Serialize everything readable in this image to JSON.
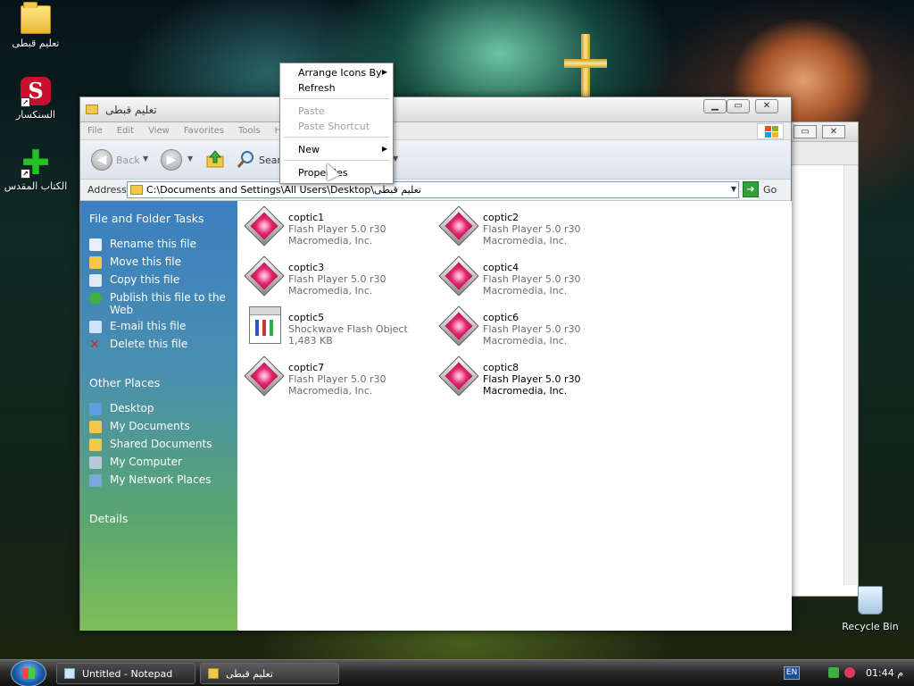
{
  "desktop": {
    "icons": [
      {
        "label": "تعليم قبطى"
      },
      {
        "label": "السنكسار"
      },
      {
        "label": "الكتاب المقدس"
      }
    ],
    "recycle_bin_label": "Recycle Bin"
  },
  "window": {
    "title": "تعليم قبطى",
    "menu": [
      "File",
      "Edit",
      "View",
      "Favorites",
      "Tools",
      "Help"
    ],
    "toolbar": {
      "back_label": "Back",
      "search_label": "Search"
    },
    "address": {
      "label": "Address",
      "value": "C:\\Documents and Settings\\All Users\\Desktop\\تعليم قبطى",
      "go_label": "Go"
    },
    "left_pane": {
      "file_tasks": {
        "heading": "File and Folder Tasks",
        "items": [
          "Rename this file",
          "Move this file",
          "Copy this file",
          "Publish this file to the Web",
          "E-mail this file",
          "Delete this file"
        ]
      },
      "other_places": {
        "heading": "Other Places",
        "items": [
          "Desktop",
          "My Documents",
          "Shared Documents",
          "My Computer",
          "My Network Places"
        ]
      },
      "details_heading": "Details"
    },
    "files": [
      {
        "name": "coptic1",
        "type": "Flash Player 5.0 r30",
        "meta": "Macromedia, Inc.",
        "icon": "flash-icon"
      },
      {
        "name": "coptic2",
        "type": "Flash Player 5.0 r30",
        "meta": "Macromedia, Inc.",
        "icon": "flash-icon"
      },
      {
        "name": "coptic3",
        "type": "Flash Player 5.0 r30",
        "meta": "Macromedia, Inc.",
        "icon": "flash-icon"
      },
      {
        "name": "coptic4",
        "type": "Flash Player 5.0 r30",
        "meta": "Macromedia, Inc.",
        "icon": "flash-icon"
      },
      {
        "name": "coptic5",
        "type": "Shockwave Flash Object",
        "meta": "1,483 KB",
        "icon": "swf-file-icon"
      },
      {
        "name": "coptic6",
        "type": "Flash Player 5.0 r30",
        "meta": "Macromedia, Inc.",
        "icon": "flash-icon"
      },
      {
        "name": "coptic7",
        "type": "Flash Player 5.0 r30",
        "meta": "Macromedia, Inc.",
        "icon": "flash-icon"
      },
      {
        "name": "coptic8",
        "type": "Flash Player 5.0 r30",
        "meta": "Macromedia, Inc.",
        "icon": "flash-icon"
      }
    ]
  },
  "context_menu": {
    "items": [
      {
        "label": "Arrange Icons By",
        "enabled": true,
        "submenu": true
      },
      {
        "label": "Refresh",
        "enabled": true,
        "submenu": false
      },
      {
        "label": "Paste",
        "enabled": false,
        "submenu": false
      },
      {
        "label": "Paste Shortcut",
        "enabled": false,
        "submenu": false
      },
      {
        "label": "New",
        "enabled": true,
        "submenu": true
      },
      {
        "label": "Properties",
        "enabled": true,
        "submenu": false
      }
    ]
  },
  "taskbar": {
    "buttons": [
      {
        "label": "Untitled - Notepad"
      },
      {
        "label": "تعليم قبطى"
      }
    ],
    "language": "EN",
    "clock": "01:44 م"
  },
  "colors": {
    "pane_top": "#3b7fc0",
    "pane_bottom": "#7fbf5a",
    "flash_pink": "#e2266f",
    "go_green": "#2fa23a"
  }
}
